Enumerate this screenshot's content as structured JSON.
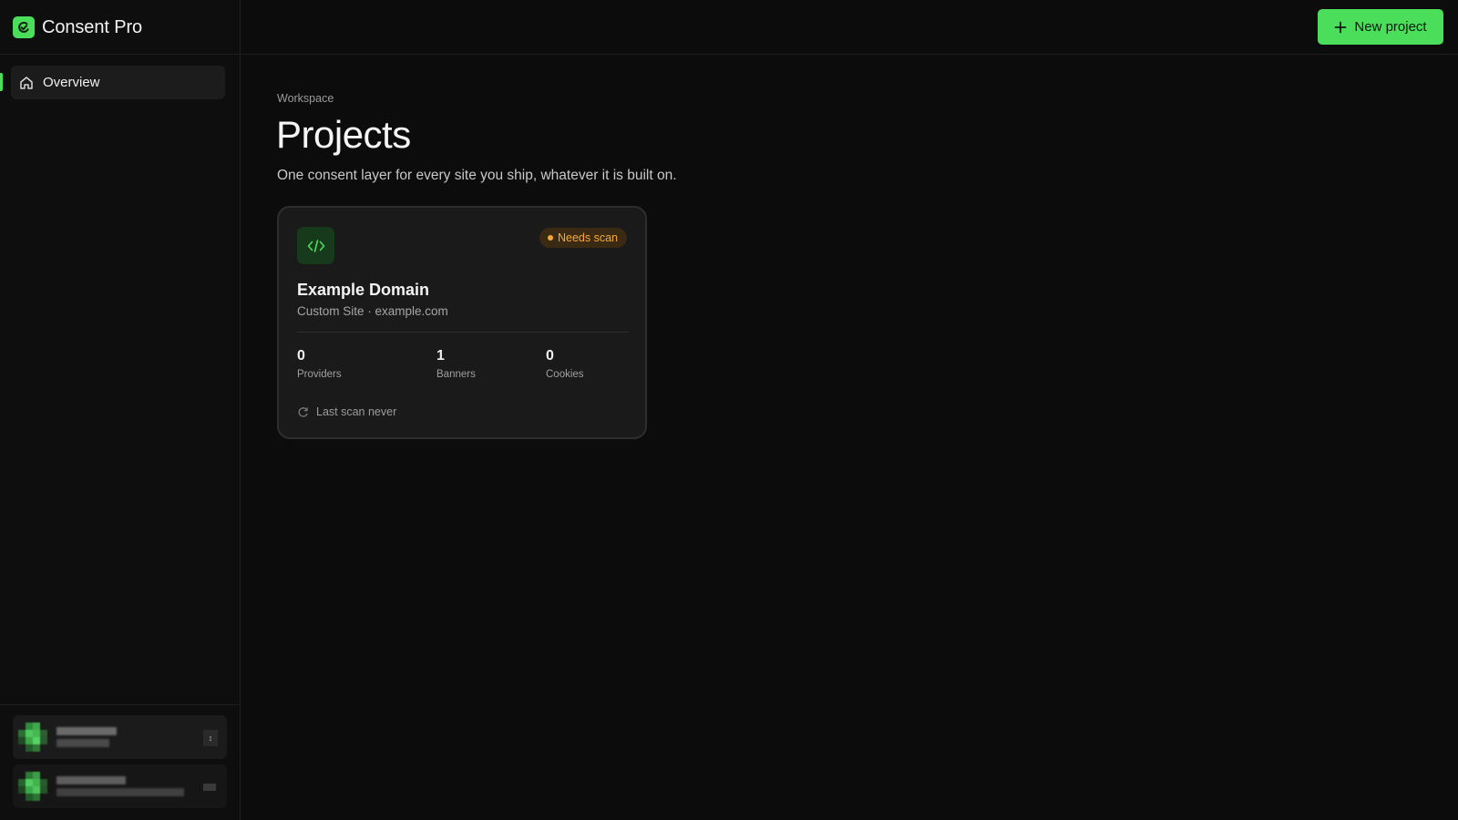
{
  "app": {
    "name": "Consent Pro",
    "accent": "#4ade5a"
  },
  "sidebar": {
    "items": [
      {
        "label": "Overview",
        "icon": "home-icon",
        "active": true
      }
    ]
  },
  "header": {
    "new_project_label": "New project"
  },
  "main": {
    "breadcrumb": "Workspace",
    "title": "Projects",
    "subtitle": "One consent layer for every site you ship, whatever it is built on."
  },
  "projects": [
    {
      "name": "Example Domain",
      "meta": "Custom Site · example.com",
      "status": "Needs scan",
      "status_color": "#f5a83a",
      "icon": "code-icon",
      "stats": [
        {
          "value": "0",
          "label": "Providers"
        },
        {
          "value": "1",
          "label": "Banners"
        },
        {
          "value": "0",
          "label": "Cookies"
        }
      ],
      "last_scan": "Last scan never"
    }
  ]
}
